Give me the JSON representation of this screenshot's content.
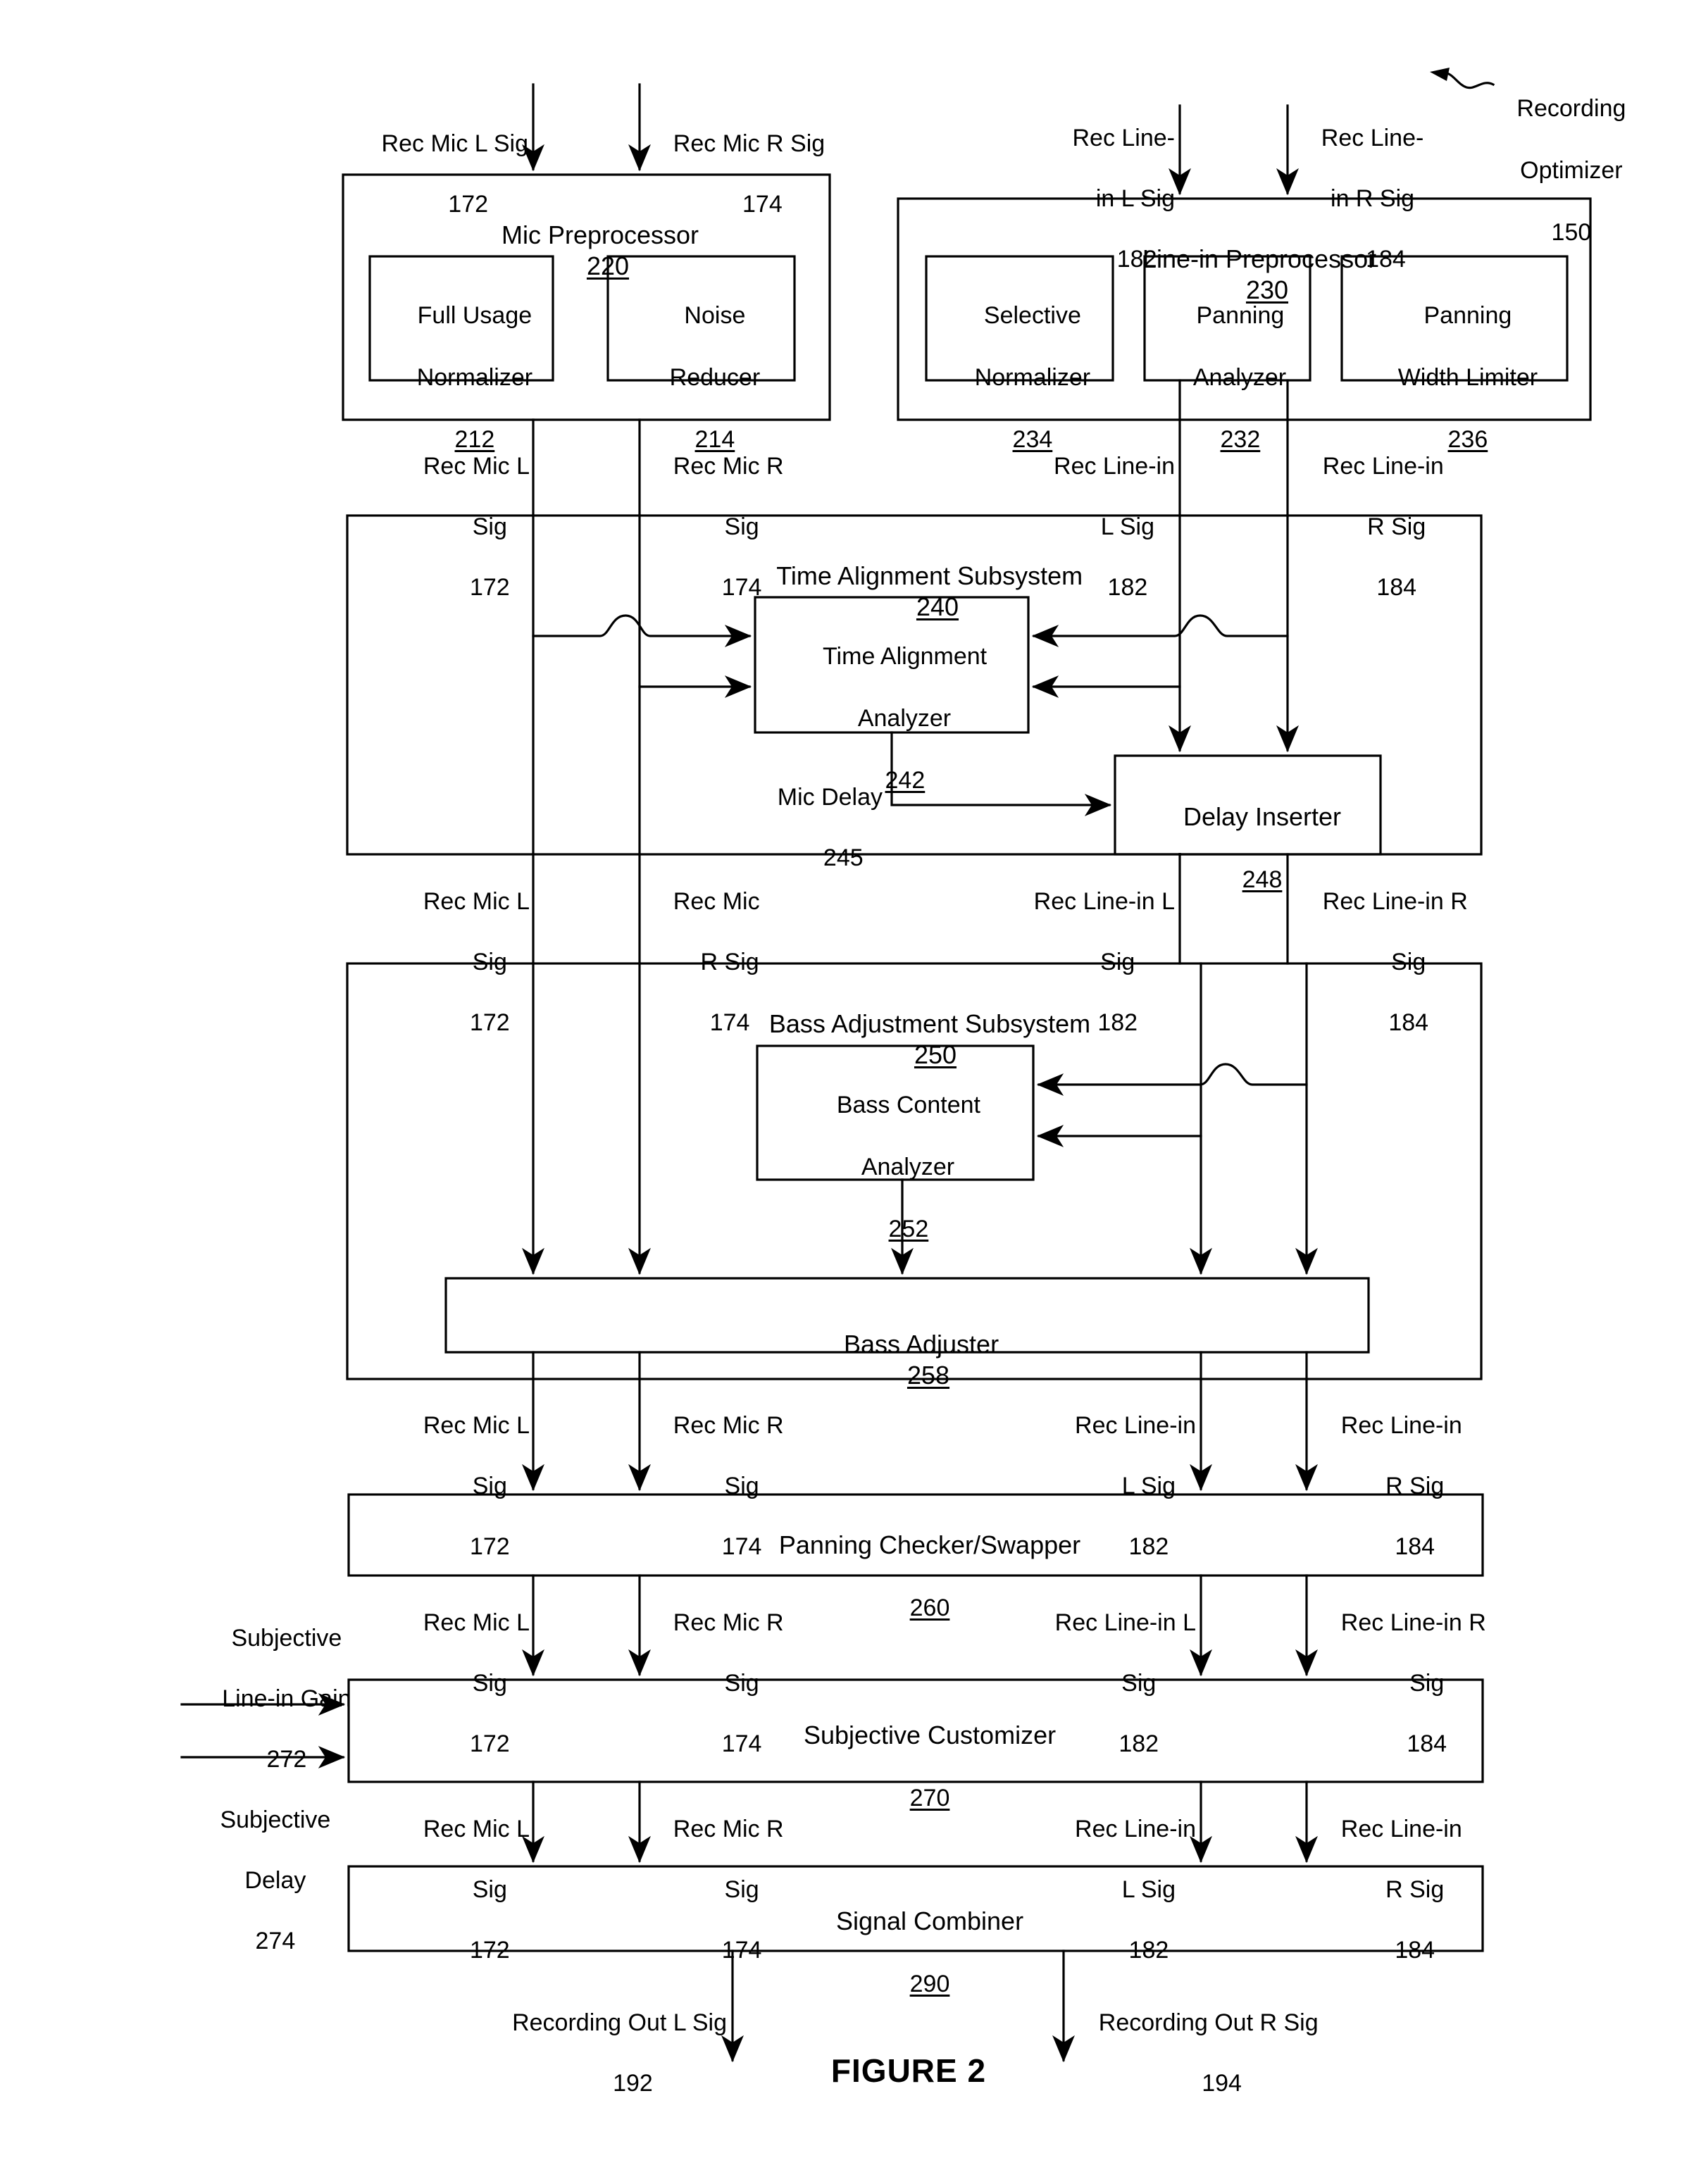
{
  "figure": {
    "caption": "FIGURE 2",
    "system_label_line1": "Recording",
    "system_label_line2": "Optimizer",
    "system_ref": "150"
  },
  "signals": {
    "mic_l": {
      "name": "Rec Mic L Sig",
      "ref": "172",
      "name_l1": "Rec Mic L",
      "name_l2": "Sig"
    },
    "mic_r": {
      "name": "Rec Mic R Sig",
      "ref": "174",
      "name_l1": "Rec Mic R",
      "name_l2": "Sig"
    },
    "line_l": {
      "name_l1": "Rec Line-",
      "name_l2": "in L Sig",
      "ref": "182",
      "alt_l1": "Rec Line-in",
      "alt_l2": "L Sig",
      "alt2_l1": "Rec Line-in L",
      "alt2_l2": "Sig"
    },
    "line_r": {
      "name_l1": "Rec Line-",
      "name_l2": "in R Sig",
      "ref": "184",
      "alt_l1": "Rec Line-in",
      "alt_l2": "R Sig",
      "alt2_l1": "Rec Line-in R",
      "alt2_l2": "Sig"
    },
    "out_l": {
      "name": "Recording Out L Sig",
      "ref": "192"
    },
    "out_r": {
      "name": "Recording Out R Sig",
      "ref": "194"
    },
    "mic_delay": {
      "name": "Mic Delay",
      "ref": "245"
    },
    "subj_gain": {
      "name_l1": "Subjective",
      "name_l2": "Line-in Gain",
      "ref": "272"
    },
    "subj_delay": {
      "name_l1": "Subjective",
      "name_l2": "Delay",
      "ref": "274"
    }
  },
  "blocks": {
    "mic_preprocessor": {
      "title": "Mic Preprocessor",
      "ref": "220"
    },
    "full_usage_normalizer": {
      "l1": "Full Usage",
      "l2": "Normalizer",
      "ref": "212"
    },
    "noise_reducer": {
      "l1": "Noise",
      "l2": "Reducer",
      "ref": "214"
    },
    "linein_preprocessor": {
      "title": "Line-in Preprocessor",
      "ref": "230"
    },
    "selective_normalizer": {
      "l1": "Selective",
      "l2": "Normalizer",
      "ref": "234"
    },
    "panning_analyzer": {
      "l1": "Panning",
      "l2": "Analyzer",
      "ref": "232"
    },
    "panning_width_limiter": {
      "l1": "Panning",
      "l2": "Width Limiter",
      "ref": "236"
    },
    "time_alignment_subsystem": {
      "title": "Time Alignment Subsystem",
      "ref": "240"
    },
    "time_alignment_analyzer": {
      "l1": "Time Alignment",
      "l2": "Analyzer",
      "ref": "242"
    },
    "delay_inserter": {
      "title": "Delay Inserter",
      "ref": "248"
    },
    "bass_adjustment_subsystem": {
      "title": "Bass Adjustment Subsystem",
      "ref": "250"
    },
    "bass_content_analyzer": {
      "l1": "Bass Content",
      "l2": "Analyzer",
      "ref": "252"
    },
    "bass_adjuster": {
      "title": "Bass Adjuster",
      "ref": "258"
    },
    "panning_checker_swapper": {
      "title": "Panning Checker/Swapper",
      "ref": "260"
    },
    "subjective_customizer": {
      "title": "Subjective Customizer",
      "ref": "270"
    },
    "signal_combiner": {
      "title": "Signal Combiner",
      "ref": "290"
    }
  },
  "colors": {
    "ink": "#000000",
    "paper": "#ffffff"
  }
}
